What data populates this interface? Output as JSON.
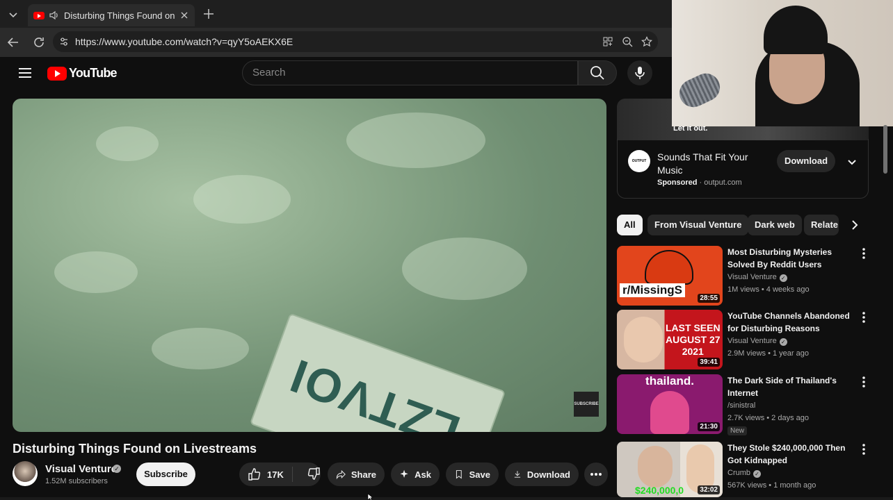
{
  "browser": {
    "tab_title": "Disturbing Things Found on L",
    "url": "https://www.youtube.com/watch?v=qyY5oAEKX6E"
  },
  "youtube": {
    "logo_text": "YouTube",
    "search_placeholder": "Search"
  },
  "video": {
    "title": "Disturbing Things Found on Livestreams",
    "plate_text": "LZTVOI",
    "watermark": "SUBSCRIBE",
    "channel": {
      "name": "Visual Venture",
      "verified": "✓",
      "subscribers": "1.52M subscribers"
    },
    "actions": {
      "subscribe": "Subscribe",
      "likes": "17K",
      "share": "Share",
      "ask": "Ask",
      "save": "Save",
      "download": "Download"
    }
  },
  "webcam": {},
  "ad": {
    "thumb_caption": "Let it out.",
    "logo_text": "OUTPUT",
    "title": "Sounds That Fit Your Music",
    "sponsored": "Sponsored",
    "domain": "output.com",
    "button": "Download"
  },
  "chips": [
    "All",
    "From Visual Venture",
    "Dark web",
    "Relate"
  ],
  "recommendations": [
    {
      "title": "Most Disturbing Mysteries Solved By Reddit Users",
      "channel": "Visual Venture",
      "verified": "✓",
      "stats": "1M views • 4 weeks ago",
      "duration": "28:55",
      "thumb_text": "r/MissingS",
      "thumb_color": "#e2451c"
    },
    {
      "title": "YouTube Channels Abandoned for Disturbing Reasons",
      "channel": "Visual Venture",
      "verified": "✓",
      "stats": "2.9M views • 1 year ago",
      "duration": "39:41",
      "thumb_text_a": "LAST SEEN",
      "thumb_text_b": "AUGUST 27",
      "thumb_text_c": "2021",
      "thumb_color": "#c4151c"
    },
    {
      "title": "The Dark Side of Thailand's Internet",
      "channel": "/sinistral",
      "stats": "2.7K views • 2 days ago",
      "badge": "New",
      "duration": "21:30",
      "thumb_text": "thailand.",
      "thumb_color": "#8a1a6e"
    },
    {
      "title": "They Stole $240,000,000 Then Got Kidnapped",
      "channel": "Crumb",
      "verified": "✓",
      "stats": "567K views • 1 month ago",
      "duration": "32:02",
      "thumb_text": "$240,000,0",
      "thumb_color": "#3a3a3a"
    }
  ]
}
